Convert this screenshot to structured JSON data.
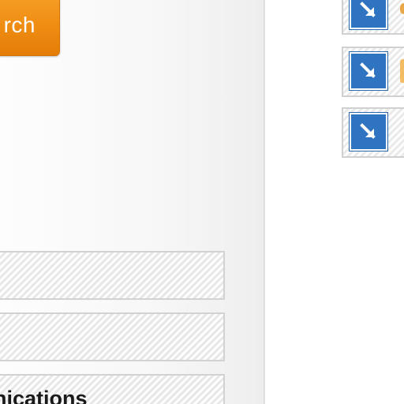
{
  "search": {
    "label": "rch",
    "color": "#f0901a"
  },
  "categories": [
    {
      "label": ""
    },
    {
      "label": ""
    },
    {
      "label": "nications"
    }
  ],
  "list_items": [
    {
      "icon": "arrow-down-right-icon",
      "color": "#2f74c0"
    },
    {
      "icon": "arrow-down-right-icon",
      "color": "#2f74c0"
    },
    {
      "icon": "arrow-down-right-icon",
      "color": "#2f74c0"
    }
  ]
}
